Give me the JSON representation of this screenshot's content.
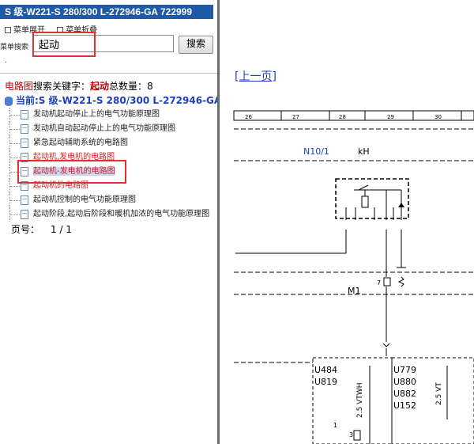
{
  "window": {
    "title": "S 级-W221-S 280/300 L-272946-GA 722999"
  },
  "menu": {
    "expand_label": "菜单展开",
    "collapse_label": "菜单折叠"
  },
  "search": {
    "label": "菜单搜索",
    "value": "起动",
    "button_label": "搜索",
    "dot": "·"
  },
  "summary": {
    "link": "电路图",
    "prefix": "搜索关键字：",
    "keyword": "起动",
    "count_label": "总数量：",
    "count": "8"
  },
  "current": {
    "label": "当前:S 级-W221-S 280/300 L-272946-GA"
  },
  "results": [
    {
      "label": "发动机起动停止上的电气功能原理图",
      "style": "normal"
    },
    {
      "label": "发动机自动起动停止上的电气功能原理图",
      "style": "normal"
    },
    {
      "label": "紧急起动辅助系统的电路图",
      "style": "normal"
    },
    {
      "label": "起动机,发电机的电路图",
      "style": "red"
    },
    {
      "label": "起动机-发电机的电路图",
      "style": "selected"
    },
    {
      "label": "起动机的电路图",
      "style": "red"
    },
    {
      "label": "起动机控制的电气功能原理图",
      "style": "normal"
    },
    {
      "label": "起动阶段,起动后阶段和暖机加浓的电气功能原理图",
      "style": "normal"
    }
  ],
  "pager": {
    "label": "页号：",
    "value": "1 / 1"
  },
  "content": {
    "prev_link": "[上一页]",
    "ruler_numbers": [
      "26",
      "27",
      "28",
      "29",
      "30"
    ],
    "components": {
      "n10": "N10/1",
      "kh": "kH",
      "m1": "M1",
      "pin7": "7",
      "pin1": "1",
      "pin3": "3"
    },
    "left_codes": [
      "U484",
      "U819"
    ],
    "right_codes": [
      "U779",
      "U880",
      "U882",
      "U152"
    ],
    "wire_left": "2.5 VTWH",
    "wire_right": "2.5 VT"
  },
  "colors": {
    "title_bg": "#1e5aa8",
    "highlight_box": "#e03030",
    "link": "#1a3fc0",
    "keyword": "#c00000"
  }
}
